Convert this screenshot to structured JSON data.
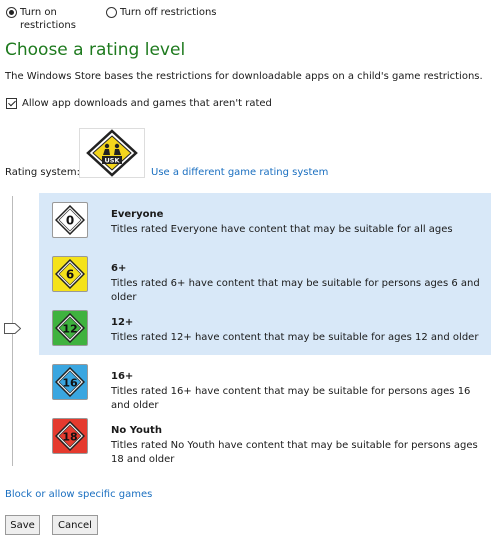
{
  "restrictions": {
    "on_label": "Turn on restrictions",
    "off_label": "Turn off restrictions"
  },
  "heading": "Choose a rating level",
  "description": "The Windows Store bases the restrictions for downloadable apps on a child's game restrictions.",
  "allow_unrated_label": "Allow app downloads and games that aren't rated",
  "rating_system": {
    "label": "Rating system:",
    "logo_text": "USK",
    "change_link": "Use a different game rating system"
  },
  "ratings": [
    {
      "badge": "0",
      "color": "#ffffff",
      "name": "Everyone",
      "text": "Titles rated Everyone have content that may be suitable for all ages",
      "selected": true
    },
    {
      "badge": "6",
      "color": "#f5e21a",
      "name": "6+",
      "text": "Titles rated 6+ have content that may be suitable for persons ages 6 and older",
      "selected": true
    },
    {
      "badge": "12",
      "color": "#3fb23f",
      "name": "12+",
      "text": "Titles rated 12+ have content that may be suitable for ages 12 and older",
      "selected": true
    },
    {
      "badge": "16",
      "color": "#3aa6e0",
      "name": "16+",
      "text": "Titles rated 16+ have content that may be suitable for persons ages 16 and older",
      "selected": false
    },
    {
      "badge": "18",
      "color": "#e53a2e",
      "name": "No Youth",
      "text": "Titles rated No Youth have content that may be suitable for persons ages 18 and older",
      "selected": false
    }
  ],
  "block_link": "Block or allow specific games",
  "buttons": {
    "save": "Save",
    "cancel": "Cancel"
  }
}
